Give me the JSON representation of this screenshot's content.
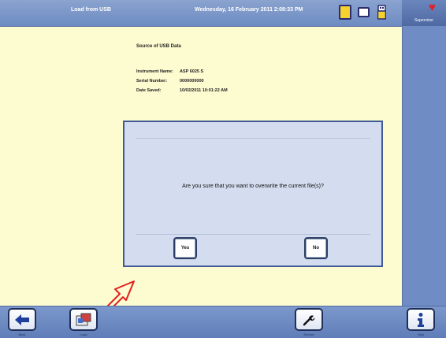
{
  "topbar": {
    "title": "Load from USB",
    "datetime": "Wednesday, 16 February 2011 2:08:33 PM"
  },
  "user": {
    "label": "Supervisor"
  },
  "content": {
    "heading": "Source of USB Data",
    "instrument_label": "Instrument Name:",
    "instrument_value": "ASP 6025 S",
    "serial_label": "Serial Number:",
    "serial_value": "0000000000",
    "date_label": "Date Saved:",
    "date_value": "10/02/2011 10:01:22 AM"
  },
  "dialog": {
    "message": "Are you sure that you want to overwrite the current file(s)?",
    "yes_label": "Yes",
    "no_label": "No"
  },
  "bottombar": {
    "back_label": "Back",
    "load_label": "Load",
    "service_label": "Service",
    "help_label": "Help"
  },
  "icons": [
    "sd-card-icon",
    "memory-card-icon",
    "usb-icon",
    "heart-icon",
    "back-arrow-icon",
    "load-icon",
    "wrench-icon",
    "info-icon",
    "annotation-arrow-icon"
  ],
  "colors": {
    "accent": "#6f8dc4",
    "background": "#fdfbd0",
    "dialog": "#d3ddef",
    "annotation": "#e02020"
  }
}
